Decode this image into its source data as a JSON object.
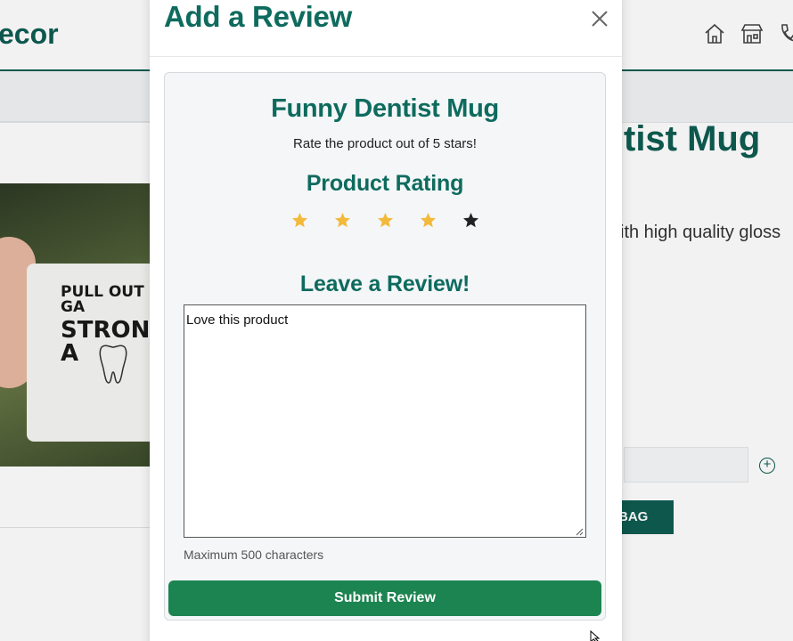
{
  "background": {
    "logo_text": "ecor",
    "product_title": "tist Mug",
    "description_fragment": "ith high quality gloss",
    "add_to_bag_label": "BAG",
    "qty_plus_label": "+",
    "mug_text_line1": "PULL OUT GA",
    "mug_text_line2": "STRONG A"
  },
  "modal": {
    "title": "Add a Review",
    "product_name": "Funny Dentist Mug",
    "rate_prompt": "Rate the product out of 5 stars!",
    "rating_title": "Product Rating",
    "rating": {
      "value": 4,
      "max": 5
    },
    "leave_title": "Leave a Review!",
    "review_text": "Love this product",
    "char_hint": "Maximum 500 characters",
    "submit_label": "Submit Review"
  },
  "colors": {
    "brand": "#0e6b5e",
    "submit": "#1c8450",
    "star_filled": "#f3b93a",
    "star_empty": "#222222"
  }
}
